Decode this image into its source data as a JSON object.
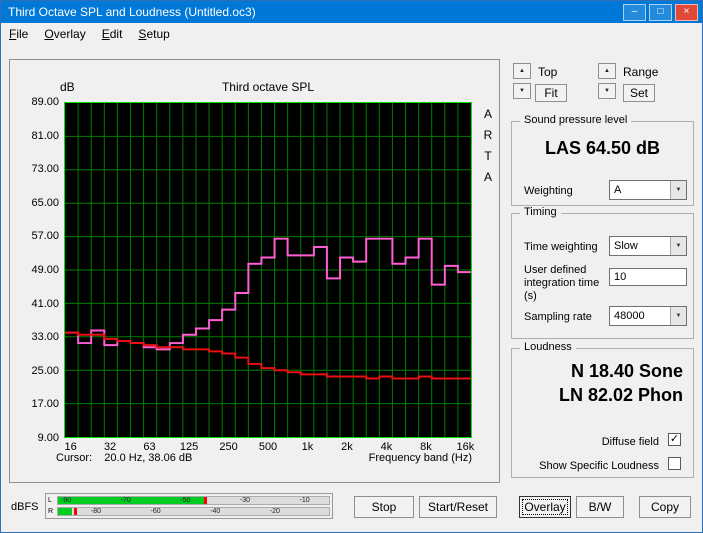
{
  "window": {
    "title": "Third Octave SPL and Loudness (Untitled.oc3)",
    "minimize_glyph": "–",
    "maximize_glyph": "□",
    "close_glyph": "×"
  },
  "icons": {
    "up": "▲",
    "down": "▼",
    "check": "✓"
  },
  "menu": {
    "items": [
      "File",
      "Overlay",
      "Edit",
      "Setup"
    ]
  },
  "chart_panel": {
    "db_label": "dB",
    "title": "Third octave SPL",
    "watermark": "ARTA",
    "cursor_text": "Cursor:    20.0 Hz, 38.06 dB",
    "x_axis_label": "Frequency band (Hz)"
  },
  "chart_data": {
    "type": "line",
    "step": true,
    "title": "Third octave SPL",
    "xlabel": "Frequency band (Hz)",
    "ylabel": "dB",
    "ylim": [
      9,
      89
    ],
    "grid": true,
    "plot_bg": "#000000",
    "grid_color": "#007d00",
    "frame_color": "#00e400",
    "yticks": [
      "89.00",
      "81.00",
      "73.00",
      "65.00",
      "57.00",
      "49.00",
      "41.00",
      "33.00",
      "25.00",
      "17.00",
      "9.00"
    ],
    "bands": [
      "16",
      "20",
      "25",
      "31.5",
      "40",
      "50",
      "63",
      "80",
      "100",
      "125",
      "160",
      "200",
      "250",
      "315",
      "400",
      "500",
      "630",
      "800",
      "1k",
      "1.25k",
      "1.6k",
      "2k",
      "2.5k",
      "3.15k",
      "4k",
      "5k",
      "6.3k",
      "8k",
      "10k",
      "12.5k",
      "16k"
    ],
    "xtick_labels": [
      "16",
      "32",
      "63",
      "125",
      "250",
      "500",
      "1k",
      "2k",
      "4k",
      "8k",
      "16k"
    ],
    "xtick_band_index": [
      0,
      3,
      6,
      9,
      12,
      15,
      18,
      21,
      24,
      27,
      30
    ],
    "series": [
      {
        "name": "Third octave SPL",
        "color": "#ff5fd2",
        "values": [
          34,
          31.5,
          34.5,
          31,
          32,
          31.5,
          30.5,
          30,
          31.5,
          33.5,
          35,
          37,
          39.5,
          43.5,
          50.5,
          52,
          56.5,
          52.5,
          52.5,
          54.5,
          47,
          52,
          51,
          56.5,
          56.5,
          50.5,
          52,
          56.5,
          45.5,
          50,
          48.5
        ]
      },
      {
        "name": "Overlay",
        "color": "#e81010",
        "values": [
          34,
          33.5,
          33.5,
          32.5,
          32,
          31.5,
          31,
          30.5,
          30.5,
          30,
          30,
          29.5,
          29,
          28,
          26.5,
          25.5,
          25,
          24.5,
          24,
          24,
          23.5,
          23.5,
          23.5,
          23,
          23.5,
          23,
          23,
          23.5,
          23,
          23,
          23
        ]
      }
    ]
  },
  "controls_top": {
    "top_label": "Top",
    "fit_button": "Fit",
    "range_label": "Range",
    "set_button": "Set"
  },
  "spl_group": {
    "title": "Sound pressure level",
    "value": "LAS 64.50 dB",
    "weighting_label": "Weighting",
    "weighting_value": "A"
  },
  "timing_group": {
    "title": "Timing",
    "time_weighting_label": "Time weighting",
    "time_weighting_value": "Slow",
    "integration_label": "User defined integration time (s)",
    "integration_value": "10",
    "sampling_label": "Sampling rate",
    "sampling_value": "48000"
  },
  "loudness_group": {
    "title": "Loudness",
    "n_value": "N 18.40 Sone",
    "ln_value": "LN 82.02 Phon",
    "diffuse_label": "Diffuse field",
    "diffuse_checked": true,
    "specific_label": "Show Specific Loudness",
    "specific_checked": false
  },
  "meter": {
    "label": "dBFS",
    "channels": [
      {
        "name": "L",
        "fill_pct": 54,
        "peak_pct": 54,
        "labels": [
          {
            "text": "-90",
            "pct": 3
          },
          {
            "text": "-70",
            "pct": 25
          },
          {
            "text": "-50",
            "pct": 47
          },
          {
            "text": "-30",
            "pct": 69
          },
          {
            "text": "-10",
            "pct": 91
          }
        ]
      },
      {
        "name": "R",
        "fill_pct": 5,
        "peak_pct": 6,
        "labels": [
          {
            "text": "-80",
            "pct": 14
          },
          {
            "text": "-60",
            "pct": 36
          },
          {
            "text": "-40",
            "pct": 58
          },
          {
            "text": "-20",
            "pct": 80
          }
        ]
      }
    ]
  },
  "buttons": [
    "Stop",
    "Start/Reset",
    "Overlay",
    "B/W",
    "Copy"
  ],
  "focused_button": "Overlay"
}
